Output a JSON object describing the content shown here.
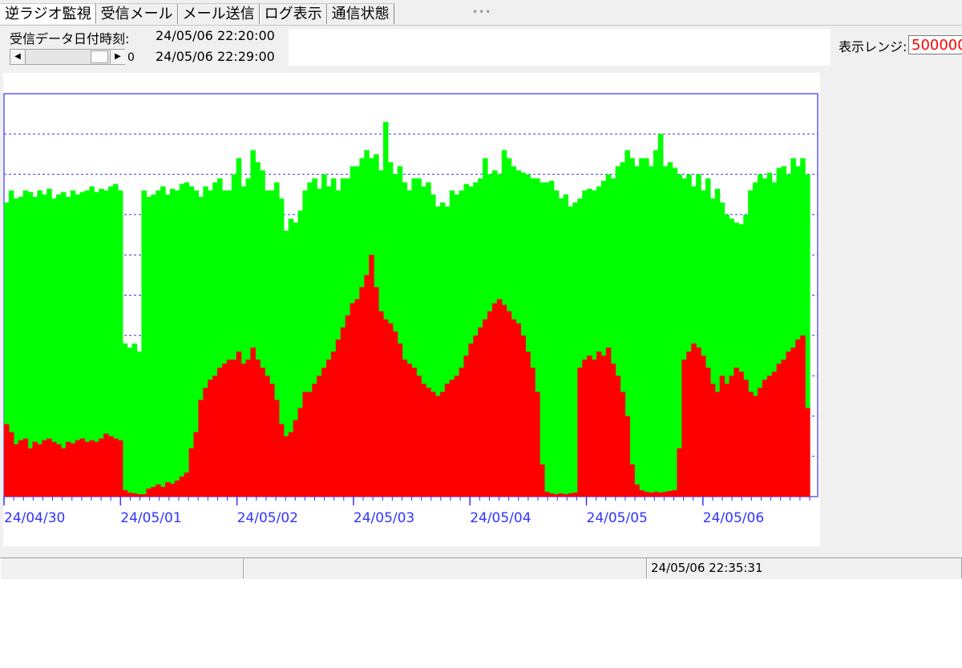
{
  "tabs": [
    {
      "label": "逆ラジオ監視",
      "active": true
    },
    {
      "label": "受信メール",
      "active": false
    },
    {
      "label": "メール送信",
      "active": false
    },
    {
      "label": "ログ表示",
      "active": false
    },
    {
      "label": "通信状態",
      "active": false
    }
  ],
  "grip_glyph": "•••",
  "header": {
    "received_label": "受信データ日付時刻:",
    "received_time_1": "24/05/06 22:20:00",
    "received_time_2": "24/05/06 22:29:00",
    "scroll_value": "0",
    "scroll_left_glyph": "◀",
    "scroll_right_glyph": "▶",
    "range_label": "表示レンジ:",
    "range_value": "500000"
  },
  "status": {
    "pane1": "",
    "pane2": "",
    "timestamp": "24/05/06 22:35:31"
  },
  "colors": {
    "green_series": "#00ff00",
    "red_series": "#ff0000",
    "axis": "#3333ff",
    "range_text": "#ff0000"
  },
  "chart_data": {
    "type": "area",
    "x_tick_labels": [
      "24/04/30",
      "24/05/01",
      "24/05/02",
      "24/05/03",
      "24/05/04",
      "24/05/05",
      "24/05/06"
    ],
    "days": 7,
    "minor_ticks_per_day": 12,
    "gridlines": 9,
    "grid": true,
    "ylim": [
      0,
      500000
    ],
    "series": [
      {
        "color": "#00ff00",
        "values": [
          365000,
          380000,
          370000,
          372000,
          380000,
          378000,
          372000,
          380000,
          375000,
          382000,
          370000,
          375000,
          378000,
          372000,
          380000,
          375000,
          378000,
          380000,
          385000,
          378000,
          382000,
          380000,
          385000,
          388000,
          380000,
          190000,
          185000,
          190000,
          180000,
          380000,
          372000,
          375000,
          380000,
          385000,
          375000,
          382000,
          380000,
          388000,
          390000,
          385000,
          380000,
          372000,
          385000,
          380000,
          390000,
          395000,
          380000,
          380000,
          400000,
          420000,
          385000,
          395000,
          430000,
          415000,
          405000,
          380000,
          380000,
          390000,
          370000,
          330000,
          345000,
          340000,
          355000,
          380000,
          390000,
          395000,
          382000,
          400000,
          385000,
          395000,
          380000,
          395000,
          395000,
          410000,
          410000,
          420000,
          430000,
          420000,
          425000,
          405000,
          465000,
          415000,
          400000,
          410000,
          390000,
          380000,
          395000,
          395000,
          385000,
          390000,
          375000,
          360000,
          365000,
          360000,
          380000,
          375000,
          380000,
          388000,
          385000,
          390000,
          395000,
          420000,
          400000,
          405000,
          400000,
          430000,
          420000,
          410000,
          405000,
          402000,
          400000,
          395000,
          395000,
          390000,
          390000,
          392000,
          380000,
          370000,
          375000,
          360000,
          365000,
          370000,
          380000,
          382000,
          380000,
          385000,
          392000,
          400000,
          395000,
          410000,
          415000,
          430000,
          420000,
          410000,
          420000,
          420000,
          410000,
          430000,
          450000,
          410000,
          415000,
          408000,
          400000,
          395000,
          400000,
          385000,
          400000,
          380000,
          395000,
          370000,
          382000,
          365000,
          350000,
          345000,
          340000,
          338000,
          350000,
          380000,
          390000,
          400000,
          395000,
          402000,
          390000,
          408000,
          410000,
          400000,
          420000,
          410000,
          420000,
          400000
        ],
        "name": ""
      },
      {
        "color": "#ff0000",
        "values": [
          90000,
          80000,
          65000,
          70000,
          72000,
          60000,
          68000,
          65000,
          70000,
          72000,
          68000,
          65000,
          60000,
          68000,
          66000,
          70000,
          72000,
          68000,
          70000,
          68000,
          72000,
          78000,
          75000,
          72000,
          70000,
          8000,
          5000,
          4000,
          3000,
          3000,
          10000,
          12000,
          15000,
          12000,
          18000,
          16000,
          20000,
          25000,
          30000,
          60000,
          80000,
          120000,
          135000,
          145000,
          150000,
          160000,
          165000,
          170000,
          170000,
          180000,
          165000,
          170000,
          185000,
          170000,
          160000,
          150000,
          140000,
          120000,
          90000,
          75000,
          80000,
          95000,
          110000,
          130000,
          130000,
          140000,
          150000,
          160000,
          170000,
          180000,
          195000,
          210000,
          225000,
          240000,
          245000,
          260000,
          275000,
          300000,
          260000,
          230000,
          220000,
          215000,
          205000,
          190000,
          170000,
          165000,
          160000,
          150000,
          140000,
          135000,
          130000,
          125000,
          130000,
          140000,
          145000,
          150000,
          160000,
          175000,
          190000,
          200000,
          210000,
          220000,
          230000,
          240000,
          245000,
          238000,
          230000,
          220000,
          215000,
          200000,
          180000,
          160000,
          130000,
          40000,
          6000,
          4000,
          3000,
          4000,
          3000,
          4000,
          5000,
          160000,
          170000,
          175000,
          170000,
          180000,
          175000,
          185000,
          165000,
          150000,
          130000,
          100000,
          40000,
          15000,
          8000,
          6000,
          5000,
          6000,
          5000,
          6000,
          7000,
          8000,
          60000,
          170000,
          180000,
          190000,
          185000,
          175000,
          160000,
          140000,
          130000,
          150000,
          140000,
          150000,
          160000,
          155000,
          145000,
          130000,
          125000,
          135000,
          145000,
          150000,
          155000,
          165000,
          170000,
          180000,
          185000,
          195000,
          200000,
          110000,
          0
        ],
        "name": ""
      }
    ]
  }
}
